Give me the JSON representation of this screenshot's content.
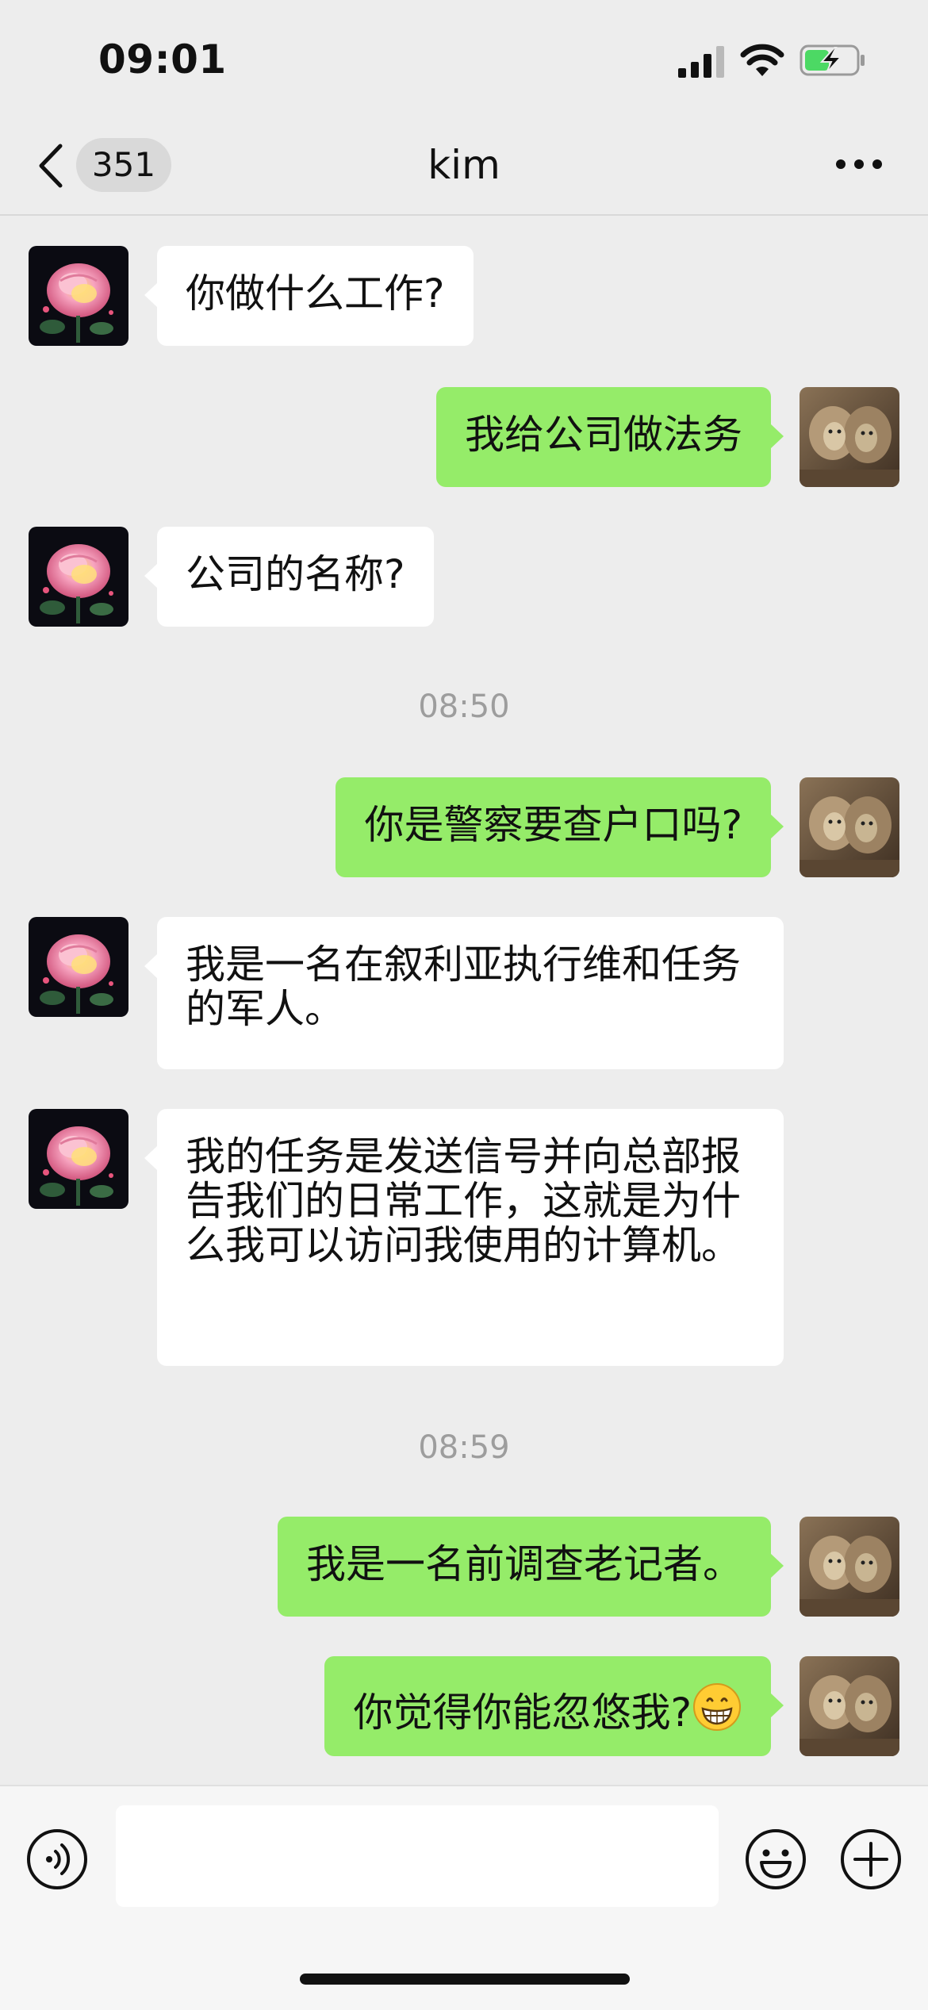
{
  "status_bar": {
    "time": "09:01"
  },
  "nav": {
    "unread_count": "351",
    "title": "kim"
  },
  "messages": [
    {
      "side": "left",
      "text": "你做什么工作?"
    },
    {
      "side": "right",
      "text": "我给公司做法务"
    },
    {
      "side": "left",
      "text": "公司的名称?"
    },
    {
      "type": "time",
      "text": "08:50"
    },
    {
      "side": "right",
      "text": "你是警察要查户口吗?"
    },
    {
      "side": "left",
      "text": "我是一名在叙利亚执行维和任务的军人。"
    },
    {
      "side": "left",
      "text": "我的任务是发送信号并向总部报告我们的日常工作，这就是为什么我可以访问我使用的计算机。"
    },
    {
      "type": "time",
      "text": "08:59"
    },
    {
      "side": "right",
      "text": "我是一名前调查老记者。"
    },
    {
      "side": "right",
      "text": "你觉得你能忽悠我?",
      "emoji": "grinning-face-emoji"
    }
  ],
  "input": {
    "value": "",
    "placeholder": ""
  },
  "icons": {
    "back": "back-chevron-icon",
    "more": "more-dots-icon",
    "voice": "voice-icon",
    "emoji": "emoji-icon",
    "plus": "plus-icon",
    "avatar_left": "rose-avatar",
    "avatar_right": "lions-avatar"
  },
  "colors": {
    "background": "#ededed",
    "bubble_self": "#95ec69",
    "bubble_other": "#ffffff",
    "timestamp": "#9d9d9d",
    "battery": "#4cd964"
  }
}
